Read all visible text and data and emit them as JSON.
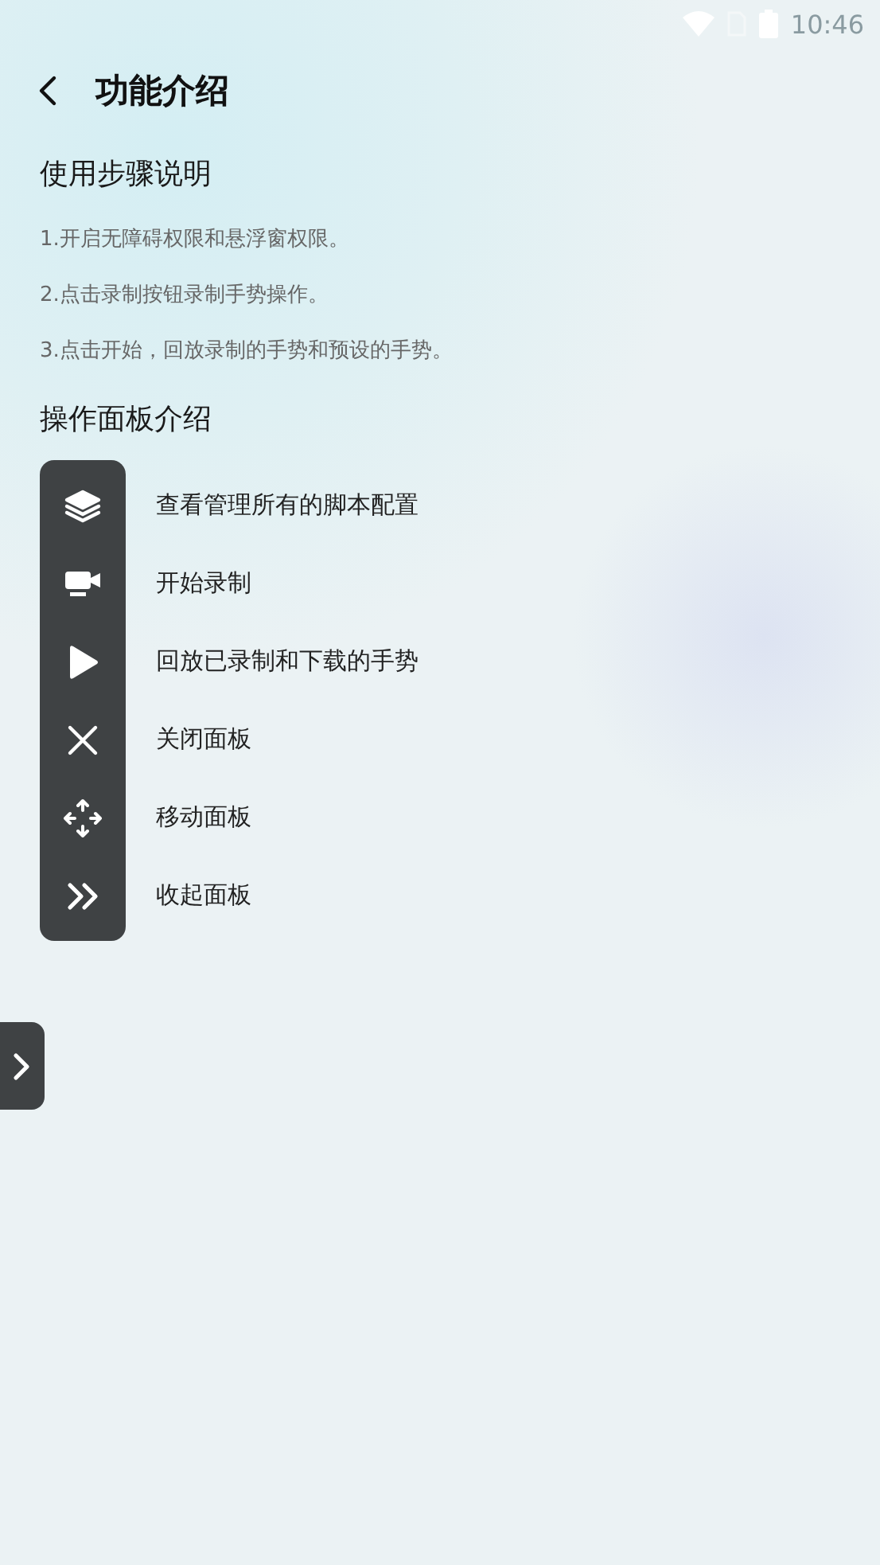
{
  "status_bar": {
    "time": "10:46"
  },
  "header": {
    "title": "功能介绍"
  },
  "usage": {
    "title": "使用步骤说明",
    "steps": [
      "1.开启无障碍权限和悬浮窗权限。",
      "2.点击录制按钮录制手势操作。",
      "3.点击开始，回放录制的手势和预设的手势。"
    ]
  },
  "panel_intro": {
    "title": "操作面板介绍",
    "items": [
      {
        "kind": "layers",
        "label": "查看管理所有的脚本配置"
      },
      {
        "kind": "camera",
        "label": "开始录制"
      },
      {
        "kind": "play",
        "label": "回放已录制和下载的手势"
      },
      {
        "kind": "close",
        "label": "关闭面板"
      },
      {
        "kind": "move",
        "label": "移动面板"
      },
      {
        "kind": "collapse",
        "label": "收起面板"
      }
    ]
  }
}
